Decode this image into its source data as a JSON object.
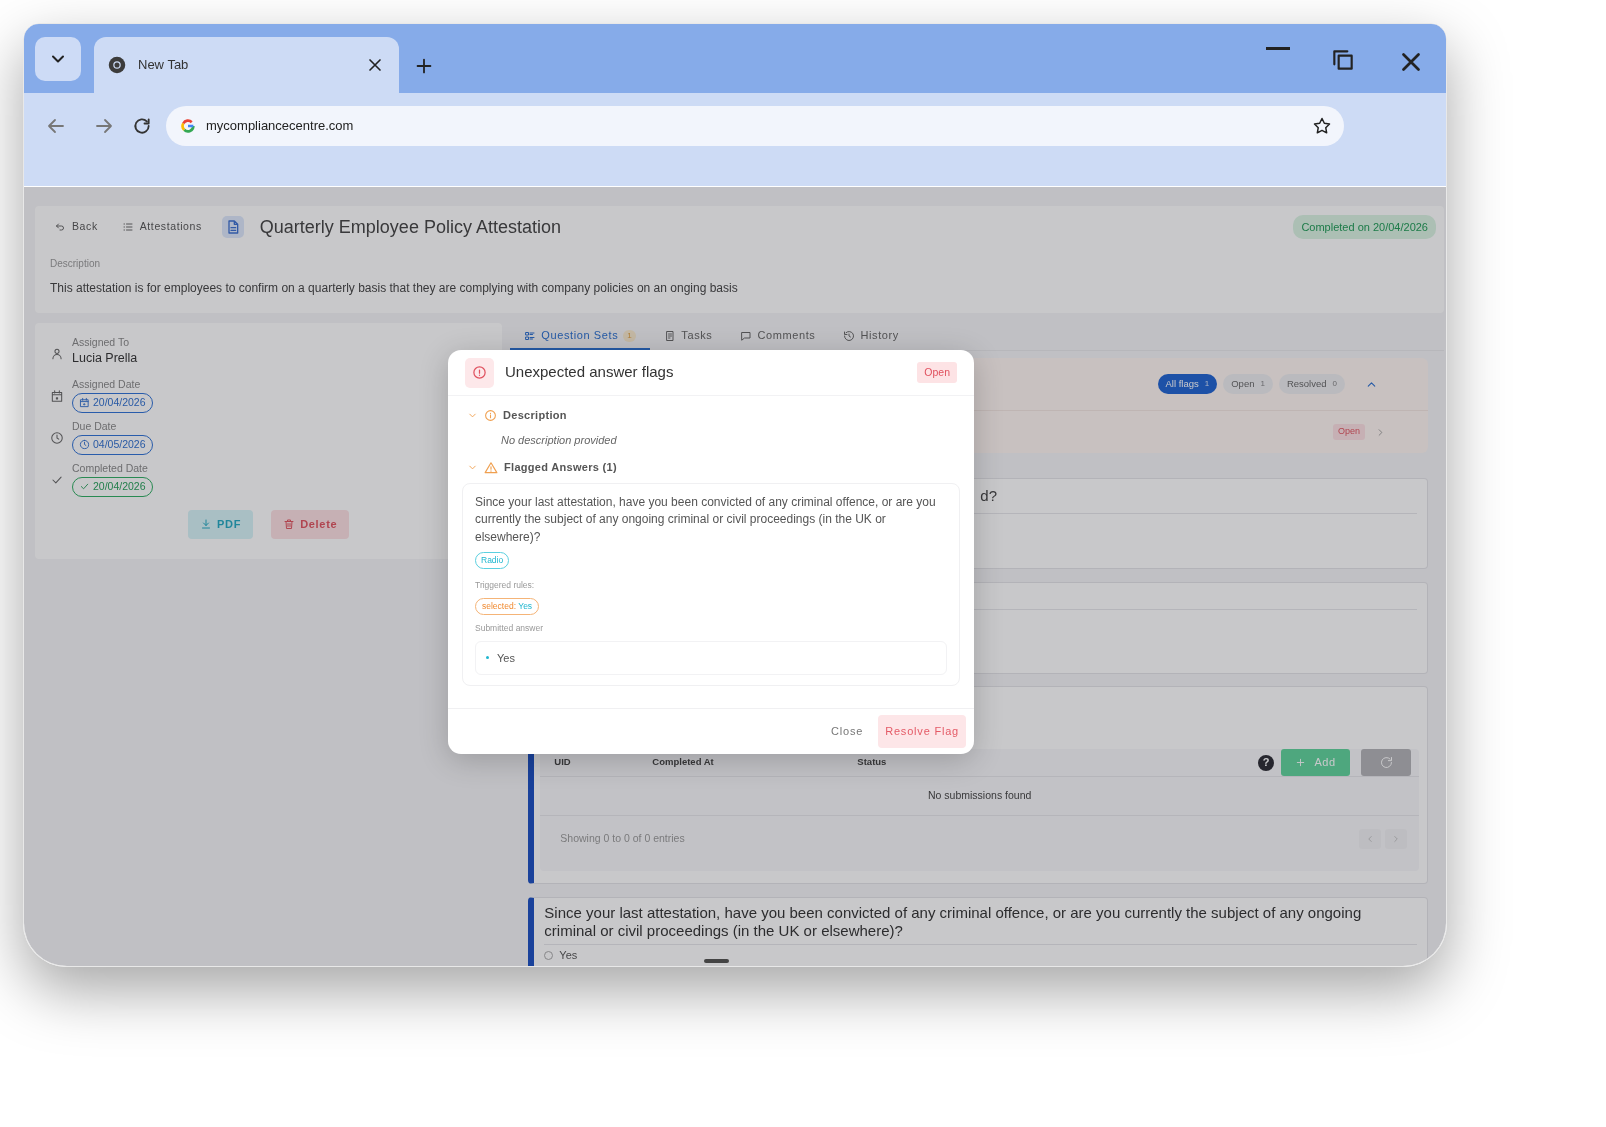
{
  "browser": {
    "tab_title": "New Tab",
    "url": "mycompliancecentre.com"
  },
  "header": {
    "back": "Back",
    "breadcrumb": "Attestations",
    "title": "Quarterly Employee Policy Attestation",
    "status_badge": "Completed on 20/04/2026",
    "description_label": "Description",
    "description": "This attestation is for employees to confirm on a quarterly basis that they are complying with company policies on an onging basis"
  },
  "details": [
    {
      "kind": "person",
      "label": "Assigned To",
      "value": "Lucia Prella"
    },
    {
      "kind": "calendar",
      "label": "Assigned Date",
      "value": "20/04/2026"
    },
    {
      "kind": "clock",
      "label": "Due Date",
      "value": "04/05/2026"
    },
    {
      "kind": "check",
      "label": "Completed Date",
      "value": "20/04/2026"
    }
  ],
  "actions": [
    {
      "kind": "pdf",
      "label": "PDF"
    },
    {
      "kind": "delete",
      "label": "Delete"
    }
  ],
  "tabs": [
    {
      "kind": "sets",
      "label": "Question Sets",
      "count": "1",
      "selected": true
    },
    {
      "kind": "tasks",
      "label": "Tasks",
      "selected": false
    },
    {
      "kind": "comments",
      "label": "Comments",
      "selected": false
    },
    {
      "kind": "history",
      "label": "History",
      "selected": false
    }
  ],
  "flags_panel": {
    "expanded": true,
    "filters": [
      {
        "label": "All flags",
        "count": "1",
        "selected": true
      },
      {
        "label": "Open",
        "count": "1",
        "selected": false
      },
      {
        "label": "Resolved",
        "count": "0",
        "selected": false
      }
    ],
    "flag_status": "Open"
  },
  "question_card_title_end": "d?",
  "submissions": {
    "columns": [
      "UID",
      "Completed At",
      "Status"
    ],
    "help": "?",
    "add_button": "Add",
    "empty_message": "No submissions found",
    "footer": "Showing 0 to 0 of 0 entries"
  },
  "question": {
    "text": "Since your last attestation, have you been convicted of any criminal offence, or are you currently the subject of any ongoing criminal or civil proceedings (in the UK or elsewhere)?",
    "options": [
      {
        "label": "Yes",
        "selected": false
      }
    ]
  },
  "modal": {
    "title": "Unexpected answer flags",
    "status": "Open",
    "description_label": "Description",
    "description_expanded": true,
    "description": "No description provided",
    "flagged_label": "Flagged Answers (1)",
    "flagged_expanded": true,
    "answers": [
      {
        "question": "Since your last attestation, have you been convicted of any criminal offence, or are you currently the subject of any ongoing criminal or civil proceedings (in the UK or elsewhere)?",
        "type": "Radio",
        "rules_label": "Triggered rules:",
        "rules": [
          {
            "key": "selected:",
            "value": "Yes"
          }
        ],
        "submitted_label": "Submitted answer",
        "submitted": [
          "Yes"
        ]
      }
    ],
    "buttons": [
      {
        "kind": "plain",
        "label": "Close"
      },
      {
        "kind": "danger",
        "label": "Resolve Flag"
      }
    ]
  }
}
